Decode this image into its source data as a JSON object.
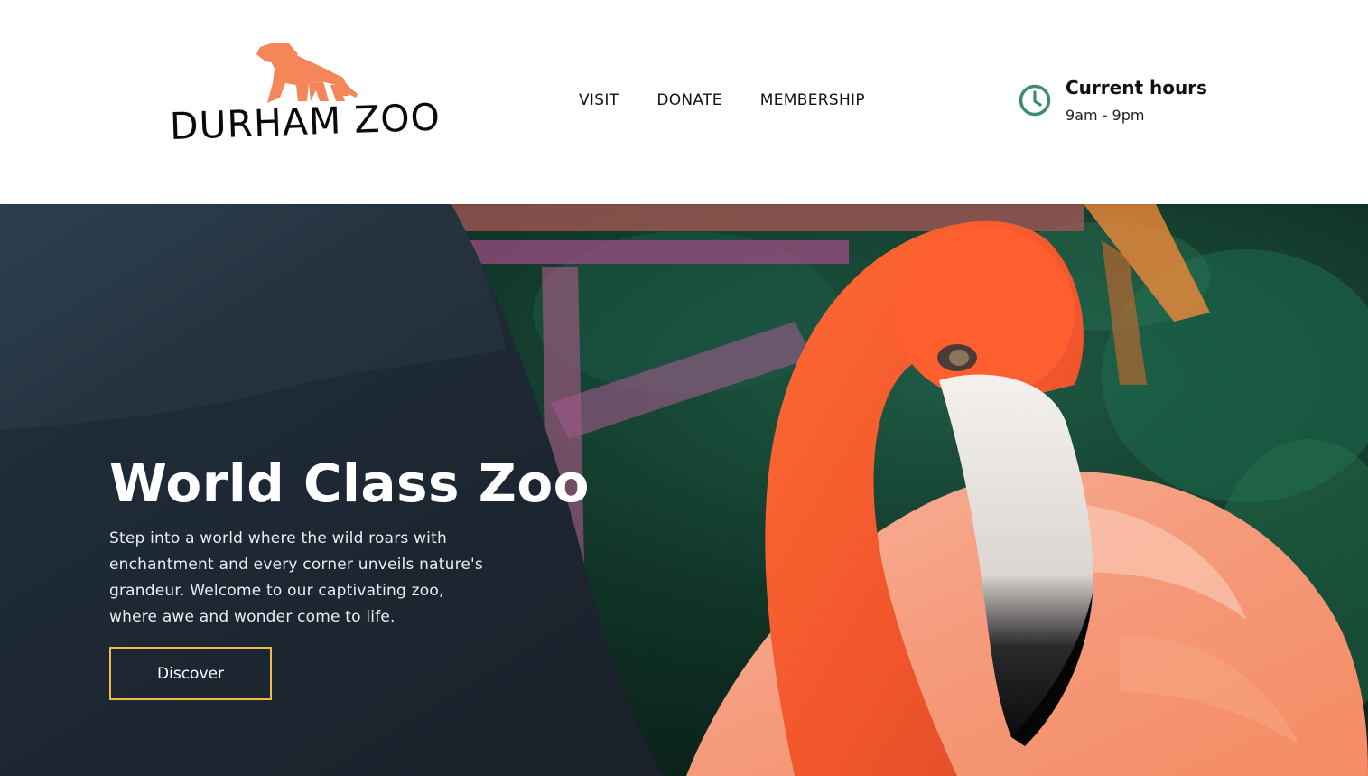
{
  "brand": {
    "name": "DURHAM ZOO",
    "logo_icon": "lion-icon",
    "logo_color": "#f4865a",
    "text_color": "#0b0b0b"
  },
  "nav": {
    "items": [
      {
        "label": "VISIT"
      },
      {
        "label": "DONATE"
      },
      {
        "label": "MEMBERSHIP"
      }
    ]
  },
  "hours": {
    "icon": "clock-icon",
    "title": "Current hours",
    "value": "9am - 9pm",
    "icon_color": "#3f8a72"
  },
  "hero": {
    "title": "World Class Zoo",
    "text": "Step into a world where the wild roars with enchantment and every corner unveils nature's grandeur. Welcome to our captivating zoo, where awe and wonder come to life.",
    "button_label": "Discover",
    "image": "flamingo-photo",
    "panel_color": "#1c2531",
    "button_border_color": "#f2b94a"
  }
}
